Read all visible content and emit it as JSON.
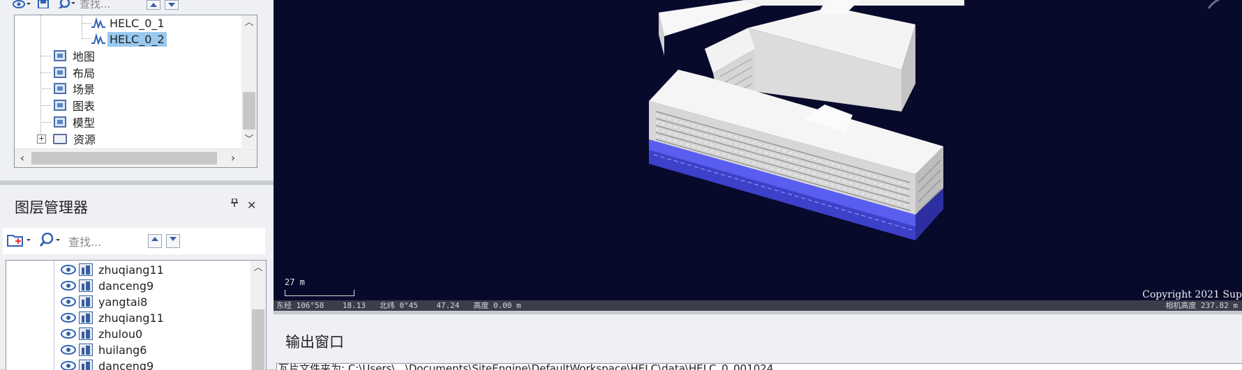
{
  "workspace": {
    "toolbar": {
      "search_placeholder": "查找..."
    },
    "tree": [
      {
        "label": "HELC_0_1",
        "type": "dataset",
        "selected": false
      },
      {
        "label": "HELC_0_2",
        "type": "dataset",
        "selected": true
      },
      {
        "label": "地图",
        "type": "node"
      },
      {
        "label": "布局",
        "type": "node"
      },
      {
        "label": "场景",
        "type": "node"
      },
      {
        "label": "图表",
        "type": "node"
      },
      {
        "label": "模型",
        "type": "node"
      },
      {
        "label": "资源",
        "type": "folder",
        "expand": "+"
      }
    ]
  },
  "layers": {
    "title": "图层管理器",
    "search_placeholder": "查找...",
    "items": [
      {
        "name": "zhuqiang11"
      },
      {
        "name": "danceng9"
      },
      {
        "name": "yangtai8"
      },
      {
        "name": "zhuqiang11"
      },
      {
        "name": "zhulou0"
      },
      {
        "name": "huilang6"
      },
      {
        "name": "danceng9"
      }
    ]
  },
  "scene": {
    "scale_label": "27 m",
    "copyright": "Copyright 2021 Sup",
    "status_left": "东经 106°58    18.13   北纬 0°45    47.24   高度 0.00 m",
    "status_right": "相机高度 237.82 m",
    "colors": {
      "background": "#080a2c",
      "building": "#f2f2f2",
      "base": "#5a5ef0"
    }
  },
  "output": {
    "title": "输出窗口",
    "text": "瓦片文件夹为: C:\\Users\\...\\Documents\\SiteEngine\\DefaultWorkspace\\HELC\\data\\HELC_0_001024"
  }
}
